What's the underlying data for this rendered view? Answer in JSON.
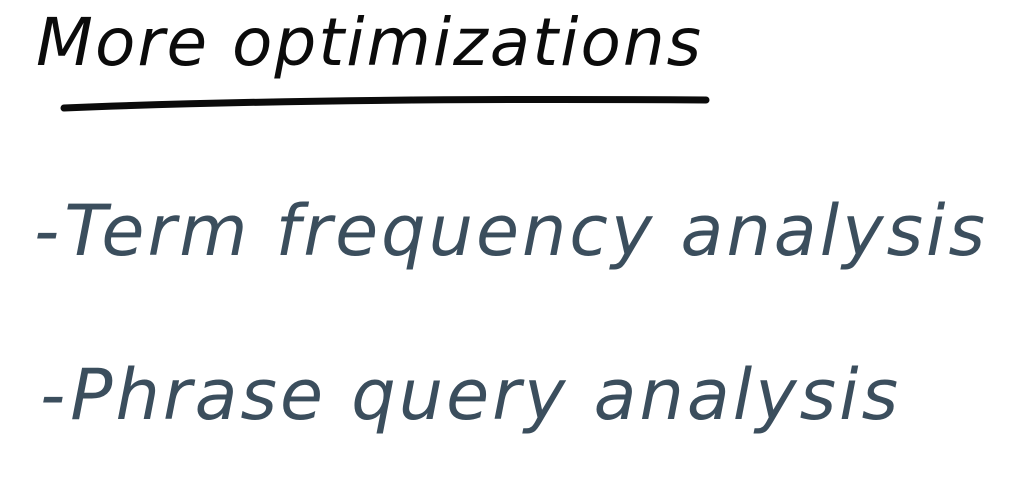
{
  "slide": {
    "title": "More optimizations",
    "bullets": [
      {
        "marker": "-",
        "text": "Term frequency analysis"
      },
      {
        "marker": "-",
        "text": "Phrase query analysis"
      }
    ],
    "colors": {
      "title": "#0b0b0b",
      "bullets": "#3b4e5d",
      "background": "#ffffff"
    }
  }
}
